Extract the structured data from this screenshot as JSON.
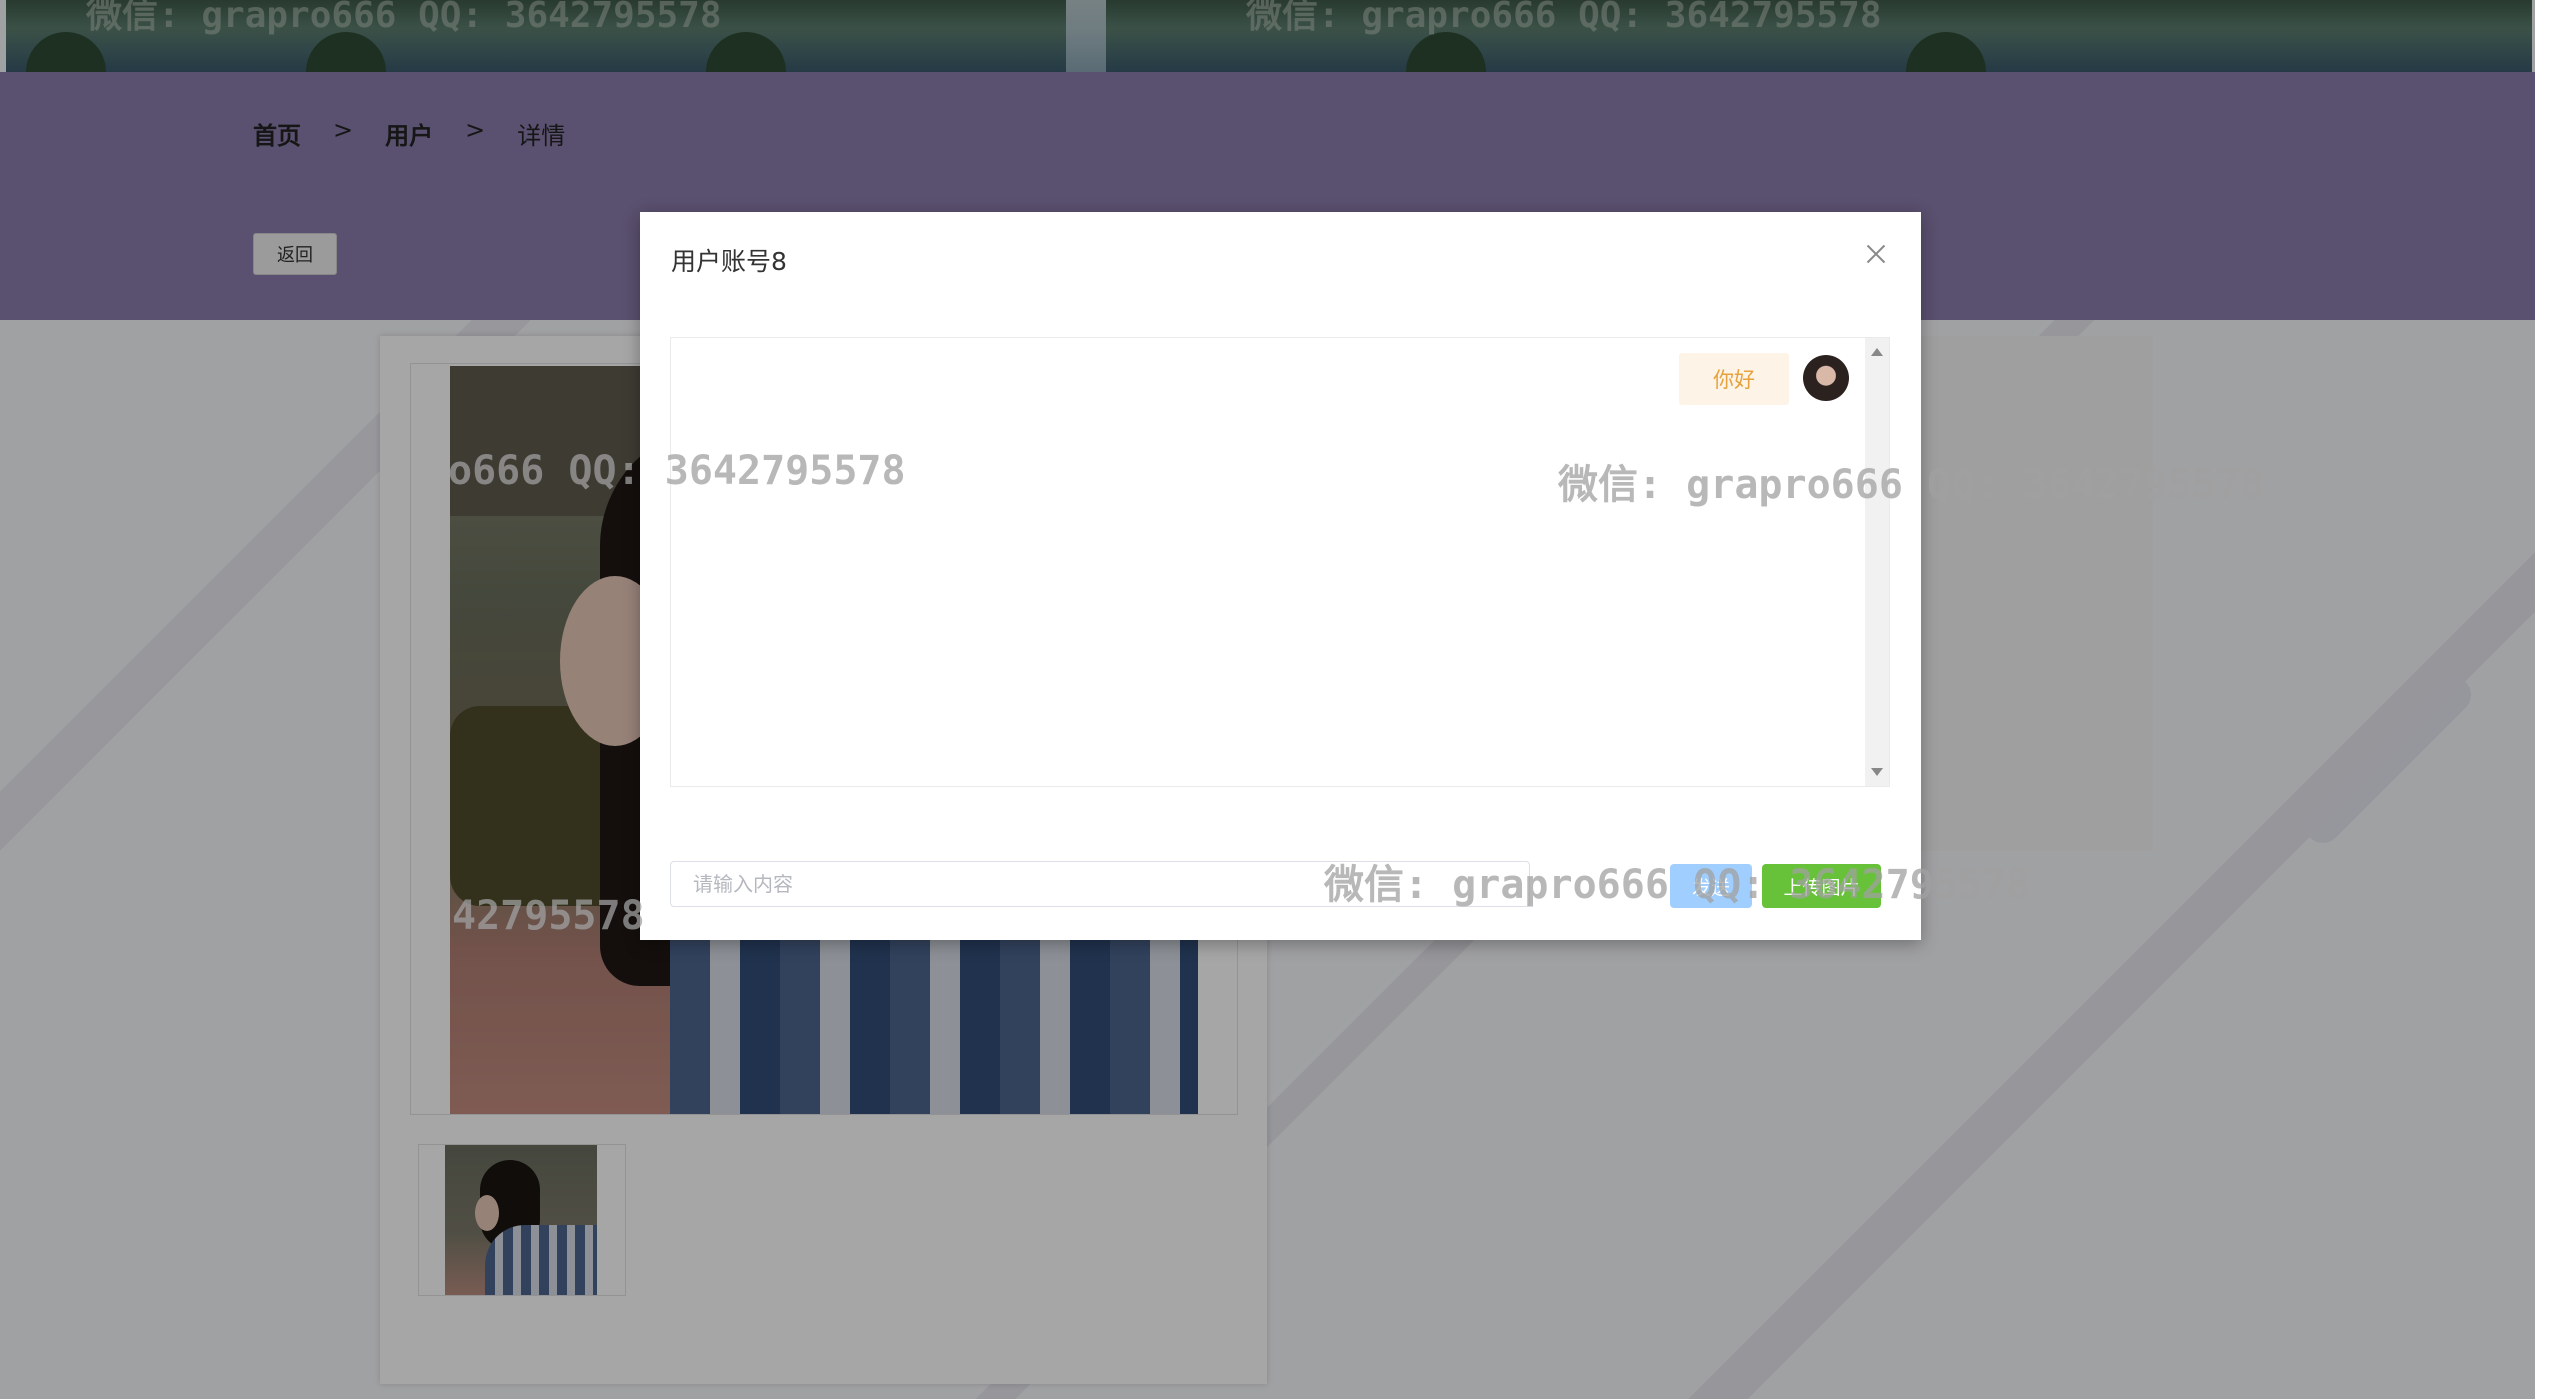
{
  "breadcrumb": {
    "home": "首页",
    "sep1": ">",
    "user": "用户",
    "sep2": ">",
    "detail": "详情"
  },
  "actions": {
    "back_label": "返回"
  },
  "modal": {
    "title": "用户账号8",
    "close_icon": "close-icon",
    "messages": [
      {
        "text": "你好",
        "avatar": "avatar"
      }
    ],
    "input_placeholder": "请输入内容",
    "input_value": "",
    "send_label": "发送",
    "upload_label": "上传图片"
  },
  "watermarks": {
    "w1": "o666 QQ: 3642795578",
    "w2": "微信: grapro666 QQ: 3642795578",
    "w3": "42795578",
    "w4": "微信: grapro666 QQ: 3642795578",
    "top1": "微信: grapro666 QQ: 3642795578",
    "top2": "微信: grapro666 QQ: 3642795578"
  },
  "colors": {
    "header": "#8b7bab",
    "send": "#a0cfff",
    "upload": "#67c23a",
    "bubble_bg": "#fdf3e7",
    "bubble_text": "#e6a23c"
  }
}
